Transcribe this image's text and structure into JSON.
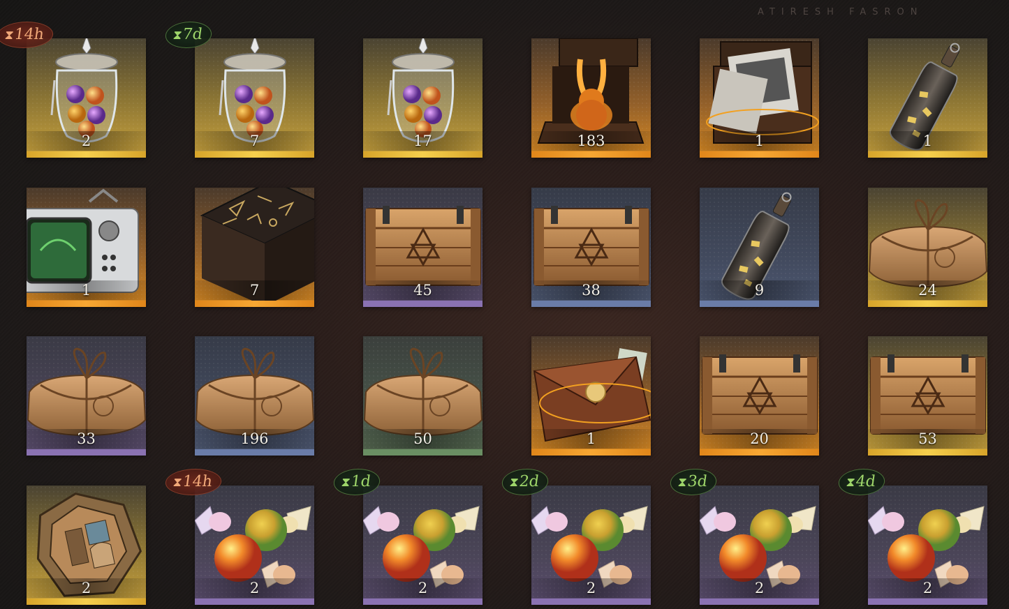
{
  "header": {
    "decoration_text": "ATIRESH FASRON"
  },
  "items": [
    {
      "icon": "orb-jar-icon",
      "count": "2",
      "rarity": "gold",
      "timer": "14h",
      "timer_style": "red"
    },
    {
      "icon": "orb-jar-icon",
      "count": "7",
      "rarity": "gold",
      "timer": "7d",
      "timer_style": "green"
    },
    {
      "icon": "orb-jar-icon",
      "count": "17",
      "rarity": "gold"
    },
    {
      "icon": "rabbit-case-icon",
      "count": "183",
      "rarity": "orange"
    },
    {
      "icon": "photo-case-icon",
      "count": "1",
      "rarity": "orange"
    },
    {
      "icon": "message-bottle-icon",
      "count": "1",
      "rarity": "gold"
    },
    {
      "icon": "retro-tv-icon",
      "count": "1",
      "rarity": "orange"
    },
    {
      "icon": "rune-table-icon",
      "count": "7",
      "rarity": "orange"
    },
    {
      "icon": "wooden-crate-icon",
      "count": "45",
      "rarity": "purple"
    },
    {
      "icon": "wooden-crate-icon",
      "count": "38",
      "rarity": "blue"
    },
    {
      "icon": "message-bottle-icon",
      "count": "9",
      "rarity": "blue"
    },
    {
      "icon": "paper-parcel-icon",
      "count": "24",
      "rarity": "gold"
    },
    {
      "icon": "paper-parcel-icon",
      "count": "33",
      "rarity": "purple"
    },
    {
      "icon": "paper-parcel-icon",
      "count": "196",
      "rarity": "blue"
    },
    {
      "icon": "paper-parcel-icon",
      "count": "50",
      "rarity": "green"
    },
    {
      "icon": "sealed-envelope-icon",
      "count": "1",
      "rarity": "orange"
    },
    {
      "icon": "wooden-crate-icon",
      "count": "20",
      "rarity": "orange"
    },
    {
      "icon": "wooden-crate-icon",
      "count": "53",
      "rarity": "gold"
    },
    {
      "icon": "puzzle-box-icon",
      "count": "2",
      "rarity": "gold"
    },
    {
      "icon": "candy-icon",
      "count": "2",
      "rarity": "purple",
      "timer": "14h",
      "timer_style": "red"
    },
    {
      "icon": "candy-icon",
      "count": "2",
      "rarity": "purple",
      "timer": "1d",
      "timer_style": "green"
    },
    {
      "icon": "candy-icon",
      "count": "2",
      "rarity": "purple",
      "timer": "2d",
      "timer_style": "green"
    },
    {
      "icon": "candy-icon",
      "count": "2",
      "rarity": "purple",
      "timer": "3d",
      "timer_style": "green"
    },
    {
      "icon": "candy-icon",
      "count": "2",
      "rarity": "purple",
      "timer": "4d",
      "timer_style": "green"
    }
  ]
}
